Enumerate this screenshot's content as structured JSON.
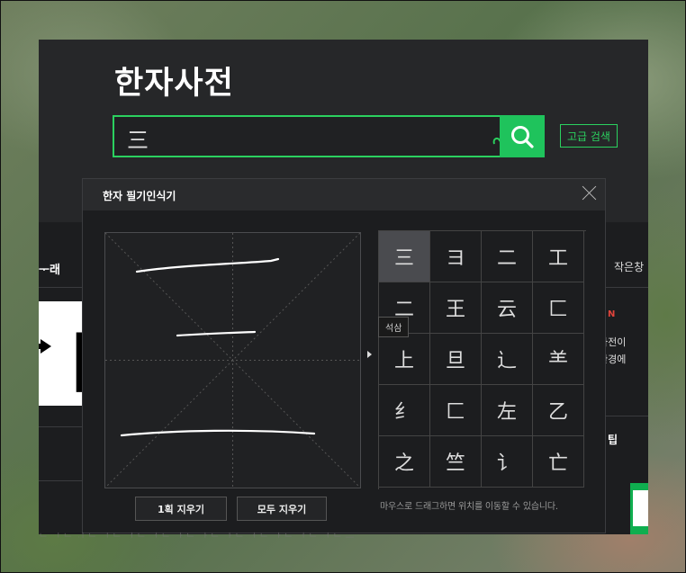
{
  "dictionary": {
    "title": "한자사전",
    "search": {
      "value": "三",
      "advanced_label": "고급 검색"
    },
    "left_side": {
      "label": "ᅮ래",
      "glyph": "自"
    },
    "right_side": {
      "label": "작은창",
      "badge": "N",
      "text_line1": "사전이",
      "text_line2": "환경에",
      "tip_label": "팁"
    },
    "bottom_text": "ᄂ ᅵ ᄂ ᆡ ᄂ ᅵ ᄂ ᅥ ᄂ ᅥ ᄂ ᅡ ᄂ ᅡ ᄂ ᅡ ᄂ ᅥ ᄂ ᅡ ᄂ ᅥ ᄂ ᅥ ᄂ ᅳ"
  },
  "handwriting": {
    "title": "한자 필기인식기",
    "clear_one_label": "1획 지우기",
    "clear_all_label": "모두 지우기",
    "hint": "마우스로 드래그하면 위치를 이동할 수 있습니다.",
    "tooltip": "석삼",
    "candidates": [
      "三",
      "ヨ",
      "二",
      "工",
      "二",
      "王",
      "云",
      "匚",
      "上",
      "旦",
      "辶",
      "⺷",
      "纟",
      "匚",
      "左",
      "乙",
      "之",
      "竺",
      "讠",
      "亡"
    ],
    "colors": {
      "accent": "#2bd15f"
    }
  }
}
